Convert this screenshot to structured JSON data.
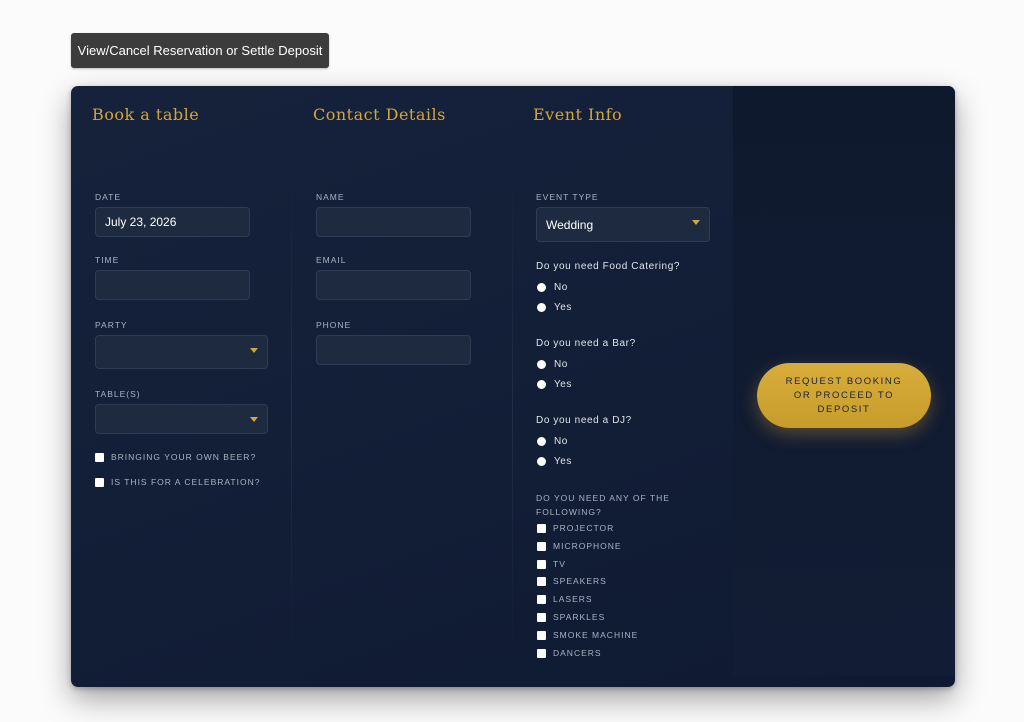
{
  "top_button": {
    "label": "View/Cancel Reservation or Settle Deposit"
  },
  "booking": {
    "heading": "Book a table",
    "date_label": "DATE",
    "date_value": "July 23, 2026",
    "time_label": "TIME",
    "time_value": "",
    "party_label": "PARTY",
    "party_value": "",
    "tables_label": "TABLE(S)",
    "tables_value": "",
    "byob_label": "BRINGING YOUR OWN BEER?",
    "celebration_label": "IS THIS FOR A CELEBRATION?"
  },
  "contact": {
    "heading": "Contact Details",
    "name_label": "NAME",
    "name_value": "",
    "email_label": "EMAIL",
    "email_value": "",
    "phone_label": "PHONE",
    "phone_value": ""
  },
  "event": {
    "heading": "Event Info",
    "type_label": "EVENT TYPE",
    "type_value": "Wedding",
    "catering_question": "Do you need Food Catering?",
    "bar_question": "Do you need a Bar?",
    "dj_question": "Do you need a DJ?",
    "no_label": "No",
    "yes_label": "Yes",
    "extras_question": "DO YOU NEED ANY OF THE FOLLOWING?",
    "extras": [
      "PROJECTOR",
      "MICROPHONE",
      "TV",
      "SPEAKERS",
      "LASERS",
      "SPARKLES",
      "SMOKE MACHINE",
      "DANCERS"
    ]
  },
  "cta": {
    "label": "REQUEST BOOKING OR PROCEED TO DEPOSIT"
  },
  "colors": {
    "accent": "#d4a53a",
    "card_bg": "#121d36",
    "field_bg": "#1d2a40"
  }
}
